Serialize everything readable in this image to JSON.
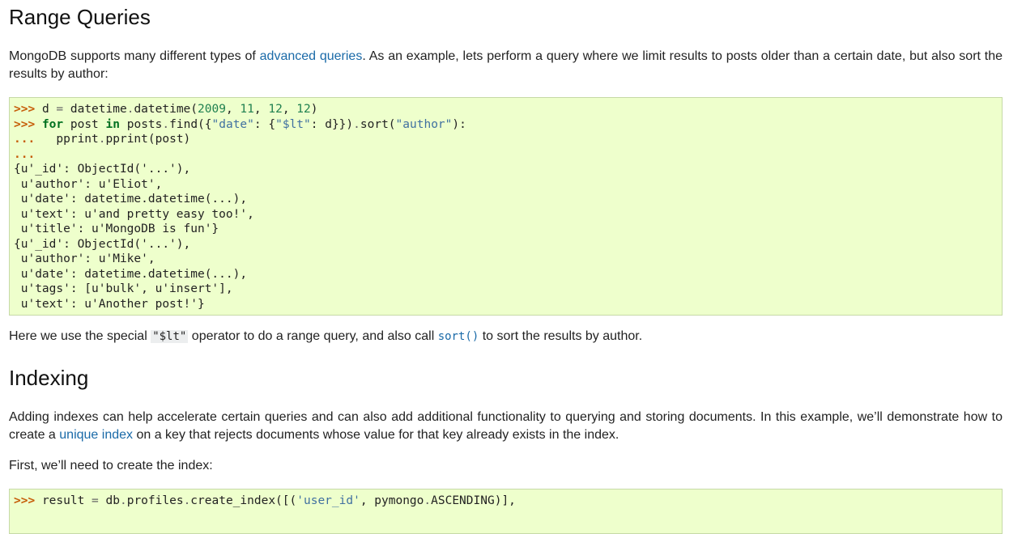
{
  "section_range": {
    "heading": "Range Queries",
    "intro_before_link": "MongoDB supports many different types of ",
    "intro_link": "advanced queries",
    "intro_after_link": ". As an example, lets perform a query where we limit results to posts older than a certain date, but also sort the results by author:",
    "code": {
      "prompt": ">>>",
      "cont": "...",
      "l1_a": "d ",
      "l1_eq": "=",
      "l1_b": " datetime",
      "l1_dot": ".",
      "l1_c": "datetime(",
      "n2009": "2009",
      "comma": ", ",
      "n11": "11",
      "n12a": "12",
      "n12b": "12",
      "close_paren": ")",
      "kw_for": "for",
      "post": " post ",
      "kw_in": "in",
      "l2_b": " posts",
      "l2_find": "find({",
      "s_date": "\"date\"",
      "colon_brace": ": {",
      "s_lt": "\"$lt\"",
      "l2_d": ": d}})",
      "l2_sort": "sort(",
      "s_author": "\"author\"",
      "paren_colon": "):",
      "l3_indent": "   pprint",
      "l3_b": "pprint(post)",
      "output": "{u'_id': ObjectId('...'),\n u'author': u'Eliot',\n u'date': datetime.datetime(...),\n u'text': u'and pretty easy too!',\n u'title': u'MongoDB is fun'}\n{u'_id': ObjectId('...'),\n u'author': u'Mike',\n u'date': datetime.datetime(...),\n u'tags': [u'bulk', u'insert'],\n u'text': u'Another post!'}"
    },
    "after_1": "Here we use the special ",
    "after_code": "\"$lt\"",
    "after_2": " operator to do a range query, and also call ",
    "after_link": "sort()",
    "after_3": " to sort the results by author."
  },
  "section_index": {
    "heading": "Indexing",
    "para1_a": "Adding indexes can help accelerate certain queries and can also add additional functionality to querying and storing documents. In this example, we’ll demonstrate how to create a ",
    "para1_link": "unique index",
    "para1_b": " on a key that rejects documents whose value for that key already exists in the index.",
    "para2": "First, we’ll need to create the index:",
    "code": {
      "prompt": ">>>",
      "a": "result ",
      "eq": "=",
      "b": " db",
      "dot": ".",
      "c": "profiles",
      "d": "create_index([(",
      "s_user": "'user_id'",
      "e": ", pymongo",
      "f": "ASCENDING)],"
    }
  }
}
